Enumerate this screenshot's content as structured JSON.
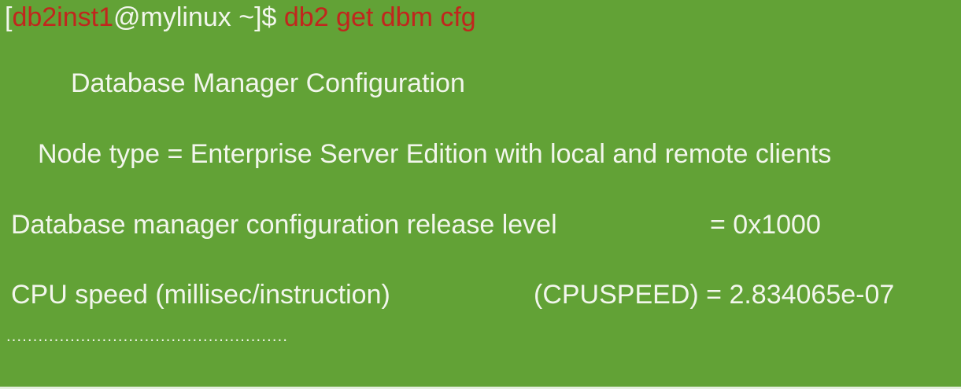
{
  "prompt": {
    "open_bracket": "[",
    "user": "db2inst1",
    "host": "@mylinux ~]$ ",
    "command": "db2 get dbm cfg"
  },
  "output": {
    "heading": "Database Manager Configuration",
    "node_type": "Node type = Enterprise Server Edition with local and remote clients",
    "release_label": "Database manager configuration release level",
    "release_value": "= 0x1000",
    "cpu_label": "CPU speed (millisec/instruction)",
    "cpu_param": "(CPUSPEED) = 2.834065e-07",
    "ellipsis": "....................................................."
  },
  "colors": {
    "background": "#62a236",
    "accent": "#c1261d",
    "text": "#f2f6ec"
  }
}
